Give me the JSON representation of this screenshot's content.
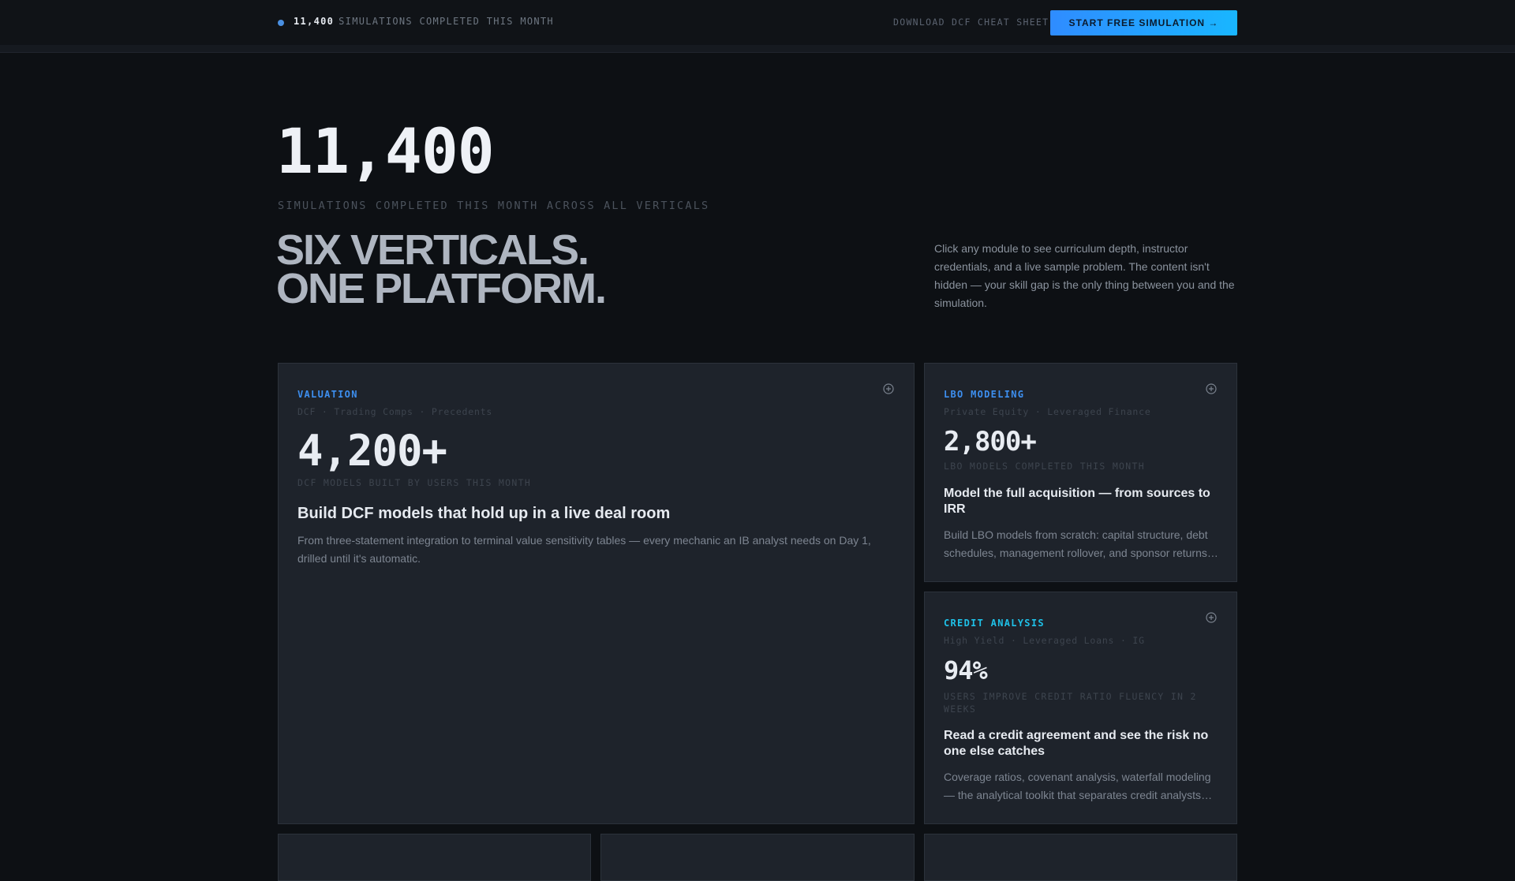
{
  "topbar": {
    "live_count": "11,400",
    "live_label": "SIMULATIONS COMPLETED THIS MONTH",
    "download_label": "DOWNLOAD DCF CHEAT SHEET",
    "cta_label": "START FREE SIMULATION →"
  },
  "hero": {
    "number": "11,400",
    "subtitle": "SIMULATIONS COMPLETED THIS MONTH ACROSS ALL VERTICALS",
    "headline_line1": "SIX VERTICALS.",
    "headline_line2": "ONE PLATFORM.",
    "intro": "Click any module to see curriculum depth, instructor credentials, and a live sample problem. The content isn't hidden — your skill gap is the only thing between you and the simulation."
  },
  "colors": {
    "accent_blue": "#3d8ff0",
    "accent_cyan": "#1fc1e8"
  },
  "cards": [
    {
      "category": "VALUATION",
      "tags": "DCF · Trading Comps · Precedents",
      "stat": "4,200+",
      "stat_label": "DCF MODELS BUILT BY USERS THIS MONTH",
      "title": "Build DCF models that hold up in a live deal room",
      "description": "From three-statement integration to terminal value sensitivity tables — every mechanic an IB analyst needs on Day 1, drilled until it's automatic.",
      "icon": "plus-circle-icon"
    },
    {
      "category": "LBO MODELING",
      "tags": "Private Equity · Leveraged Finance",
      "stat": "2,800+",
      "stat_label": "LBO MODELS COMPLETED THIS MONTH",
      "title": "Model the full acquisition — from sources to IRR",
      "description": "Build LBO models from scratch: capital structure, debt schedules, management rollover, and sponsor returns analysis.",
      "icon": "plus-circle-icon"
    },
    {
      "category": "CREDIT ANALYSIS",
      "tags": "High Yield · Leveraged Loans · IG",
      "stat": "94%",
      "stat_label": "USERS IMPROVE CREDIT RATIO FLUENCY IN 2 WEEKS",
      "title": "Read a credit agreement and see the risk no one else catches",
      "description": "Coverage ratios, covenant analysis, waterfall modeling — the analytical toolkit that separates credit analysts from the rest.",
      "icon": "plus-circle-icon"
    }
  ]
}
